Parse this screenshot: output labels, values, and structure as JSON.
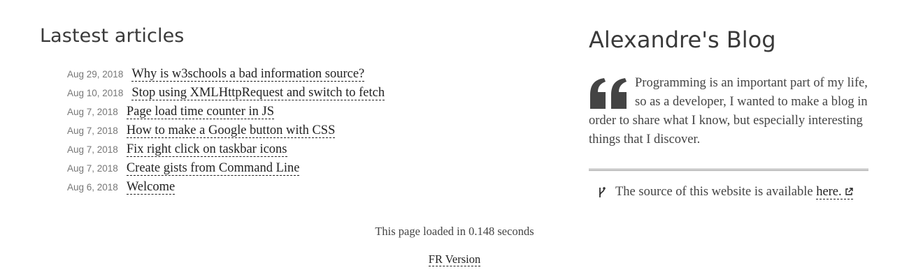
{
  "latest": {
    "title": "Lastest articles",
    "articles": [
      {
        "date": "Aug 29, 2018",
        "title": "Why is w3schools a bad information source?"
      },
      {
        "date": "Aug 10, 2018",
        "title": "Stop using XMLHttpRequest and switch to fetch"
      },
      {
        "date": "Aug 7, 2018",
        "title": "Page load time counter in JS"
      },
      {
        "date": "Aug 7, 2018",
        "title": "How to make a Google button with CSS"
      },
      {
        "date": "Aug 7, 2018",
        "title": "Fix right click on taskbar icons"
      },
      {
        "date": "Aug 7, 2018",
        "title": "Create gists from Command Line"
      },
      {
        "date": "Aug 6, 2018",
        "title": "Welcome"
      }
    ]
  },
  "sidebar": {
    "blog_title": "Alexandre's Blog",
    "quote": "Programming is an important part of my life, so as a developer, I wanted to make a blog in order to share what I know, but especially interesting things that I discover.",
    "source_text": "The source of this website is available",
    "source_link": "here."
  },
  "footer": {
    "load_time": "This page loaded in 0.148 seconds",
    "lang_link": "FR Version"
  },
  "icons": {
    "quote": "quote-icon",
    "branch": "git-branch-icon",
    "external": "external-link-icon"
  },
  "colors": {
    "text": "#333333",
    "date": "#777777",
    "rule": "#999999"
  }
}
